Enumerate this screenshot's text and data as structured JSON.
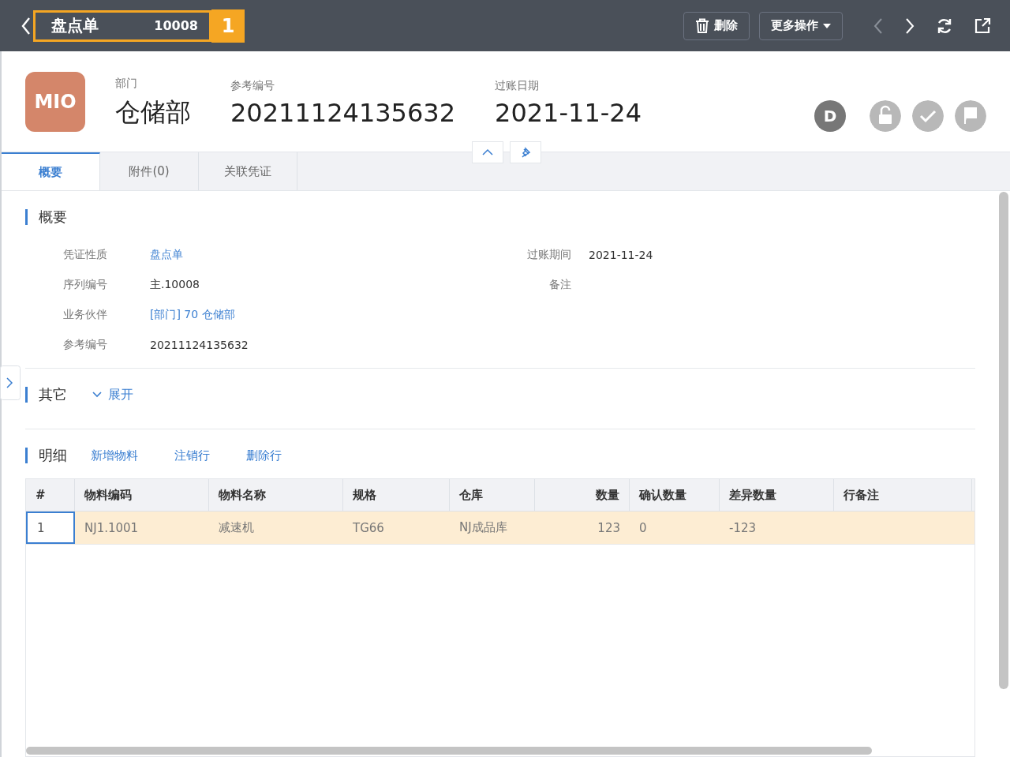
{
  "header": {
    "title": "盘点单",
    "number": "10008",
    "annotation": "1",
    "buttons": [
      {
        "kind": "delete",
        "label": "删除"
      },
      {
        "kind": "more",
        "label": "更多操作"
      }
    ],
    "nav": [
      {
        "kind": "prev",
        "disabled": true
      },
      {
        "kind": "next",
        "disabled": false
      },
      {
        "kind": "refresh",
        "disabled": false
      },
      {
        "kind": "share",
        "disabled": false
      }
    ]
  },
  "summary": {
    "logo": "MIO",
    "fields": [
      {
        "label": "部门",
        "value": "仓储部"
      },
      {
        "label": "参考编号",
        "value": "20211124135632"
      },
      {
        "label": "过账日期",
        "value": "2021-11-24"
      }
    ],
    "status": [
      {
        "kind": "letter",
        "text": "D",
        "active": true
      },
      {
        "kind": "lock",
        "active": false
      },
      {
        "kind": "check",
        "active": false
      },
      {
        "kind": "flag",
        "active": false
      }
    ]
  },
  "tabs": [
    {
      "label": "概要",
      "selected": true
    },
    {
      "label": "附件(0)",
      "selected": false
    },
    {
      "label": "关联凭证",
      "selected": false
    }
  ],
  "overview": {
    "title": "概要",
    "left": [
      {
        "label": "凭证性质",
        "value": "盘点单",
        "link": true
      },
      {
        "label": "序列编号",
        "value": "主.10008",
        "link": false
      },
      {
        "label": "业务伙伴",
        "value": "[部门] 70 仓储部",
        "link": true
      },
      {
        "label": "参考编号",
        "value": "20211124135632",
        "link": false
      }
    ],
    "right": [
      {
        "label": "过账期间",
        "value": "2021-11-24"
      },
      {
        "label": "备注"
      }
    ]
  },
  "other": {
    "title": "其它",
    "toggle": "展开",
    "expanded": false
  },
  "detail": {
    "title": "明细",
    "actions": [
      "新增物料",
      "注销行",
      "删除行"
    ],
    "columns": [
      {
        "label": "#",
        "kind": "text"
      },
      {
        "label": "物料编码",
        "kind": "text"
      },
      {
        "label": "物料名称",
        "kind": "text"
      },
      {
        "label": "规格",
        "kind": "text"
      },
      {
        "label": "仓库",
        "kind": "text"
      },
      {
        "label": "数量",
        "kind": "number"
      },
      {
        "label": "确认数量",
        "kind": "text"
      },
      {
        "label": "差异数量",
        "kind": "text"
      },
      {
        "label": "行备注",
        "kind": "text"
      }
    ],
    "rows": [
      {
        "selected": true,
        "cells": [
          "1",
          "NJ1.1001",
          "减速机",
          "TG66",
          "NJ成品库",
          "123",
          "0",
          "-123",
          ""
        ]
      }
    ]
  }
}
